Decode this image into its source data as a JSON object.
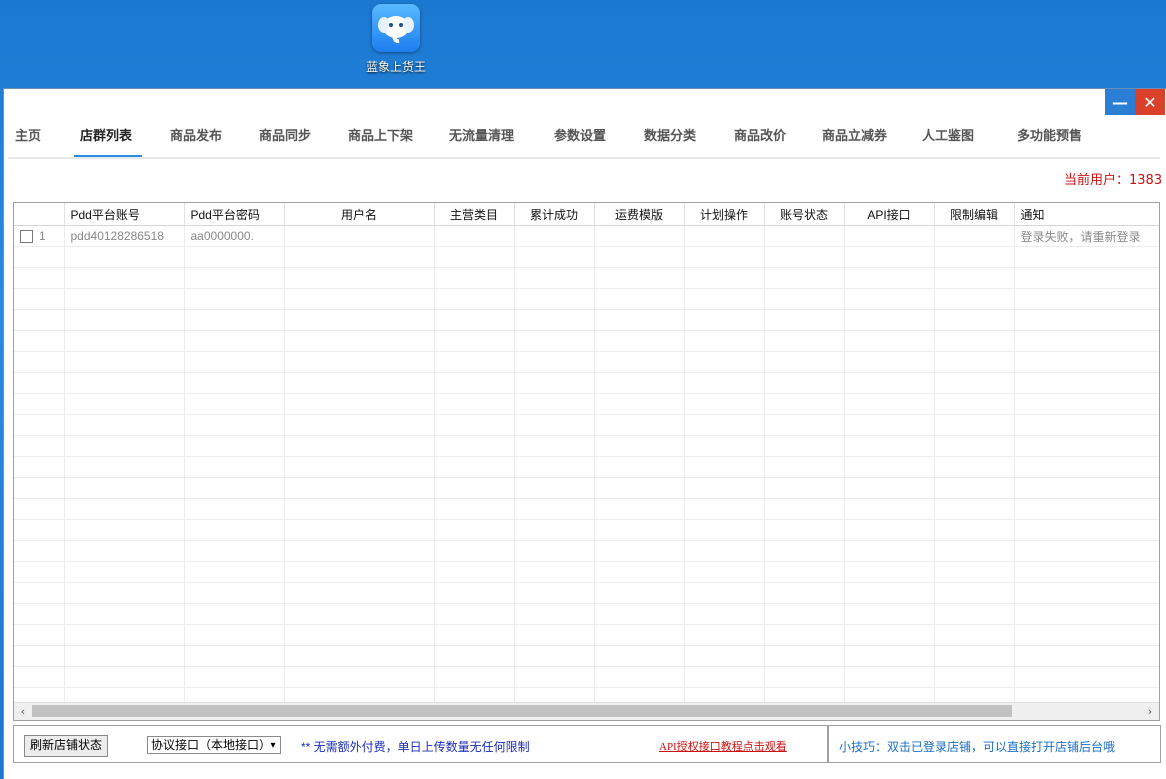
{
  "desktop": {
    "icon_label": "蓝象上货王"
  },
  "window": {
    "minimize": "—",
    "close": "✕"
  },
  "tabs": [
    {
      "label": "主页"
    },
    {
      "label": "店群列表"
    },
    {
      "label": "商品发布"
    },
    {
      "label": "商品同步"
    },
    {
      "label": "商品上下架"
    },
    {
      "label": "无流量清理"
    },
    {
      "label": "参数设置"
    },
    {
      "label": "数据分类"
    },
    {
      "label": "商品改价"
    },
    {
      "label": "商品立减券"
    },
    {
      "label": "人工鉴图"
    },
    {
      "label": "多功能预售"
    }
  ],
  "active_tab": "店群列表",
  "user": {
    "label": "当前用户：1383"
  },
  "table": {
    "columns": [
      "",
      "Pdd平台账号",
      "Pdd平台密码",
      "用户名",
      "主营类目",
      "累计成功",
      "运费模版",
      "计划操作",
      "账号状态",
      "API接口",
      "限制编辑",
      "通知"
    ],
    "rows": [
      {
        "index": "1",
        "account": "pdd40128286518",
        "password": "aa0000000.",
        "username": "",
        "category": "",
        "success": "",
        "freight": "",
        "plan": "",
        "status": "",
        "api": "",
        "limit": "",
        "notice": "登录失败，请重新登录"
      }
    ]
  },
  "bottom": {
    "refresh_label": "刷新店铺状态",
    "select_value": "协议接口（本地接口）",
    "note": "**  无需额外付费，单日上传数量无任何限制",
    "api_link": "API授权接口教程点击观看",
    "tip": "小技巧：双击已登录店铺，可以直接打开店铺后台哦"
  }
}
